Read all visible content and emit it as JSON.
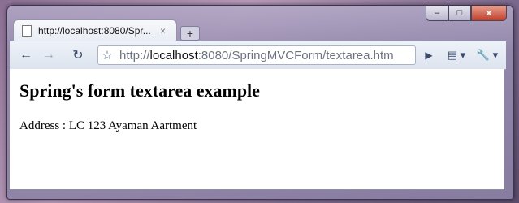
{
  "browser": {
    "tab_title": "http://localhost:8080/Spr...",
    "tab_close": "×",
    "new_tab": "+",
    "url_prefix": "http://",
    "url_host": "localhost",
    "url_rest": ":8080/SpringMVCForm/textarea.htm",
    "window_controls": {
      "minimize": "–",
      "maximize": "□",
      "close": "✕"
    },
    "toolbar": {
      "back": "←",
      "forward": "→",
      "reload": "↻",
      "star": "☆",
      "go": "▶",
      "page": "▤ ▾",
      "wrench": "🔧 ▾"
    }
  },
  "page": {
    "heading": "Spring's form textarea example",
    "address_label": "Address : LC 123 Ayaman Aartment"
  }
}
